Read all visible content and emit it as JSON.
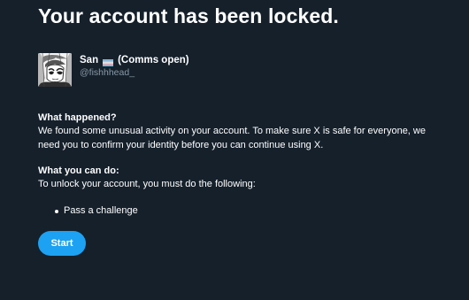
{
  "page": {
    "title": "Your account has been locked."
  },
  "account": {
    "display_name_prefix": "San",
    "flag_icon": "transgender-pride-flag-icon",
    "display_name_suffix": "(Comms open)",
    "handle": "@fishhhead_",
    "avatar_icon": "manga-avatar-icon"
  },
  "what_happened": {
    "heading": "What happened?",
    "body": "We found some unusual activity on your account. To make sure X is safe for everyone, we need you to confirm your identity before you can continue using X."
  },
  "what_you_can_do": {
    "heading": "What you can do:",
    "body": "To unlock your account, you must do the following:",
    "items": [
      {
        "label": "Pass a challenge"
      }
    ]
  },
  "actions": {
    "start_label": "Start"
  },
  "colors": {
    "background": "#15202b",
    "text": "#ffffff",
    "muted_text": "#8899a6",
    "accent": "#1da1f2",
    "flag_blue": "#5bcefa",
    "flag_pink": "#f5a9b8",
    "flag_white": "#ffffff"
  }
}
